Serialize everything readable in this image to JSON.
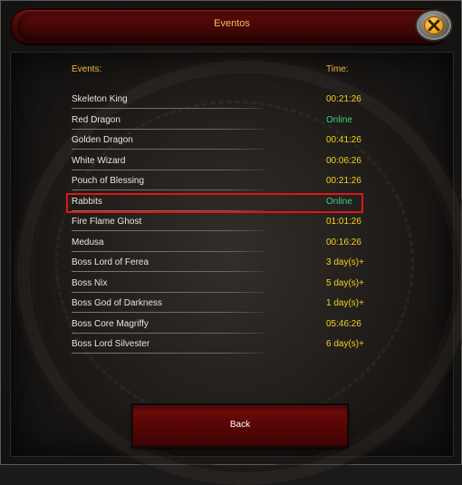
{
  "window": {
    "title": "Eventos"
  },
  "columns": {
    "events": "Events:",
    "time": "Time:"
  },
  "events": [
    {
      "name": "Skeleton King",
      "time": "00:21:26",
      "status": "countdown"
    },
    {
      "name": "Red Dragon",
      "time": "Online",
      "status": "online"
    },
    {
      "name": "Golden Dragon",
      "time": "00:41:26",
      "status": "countdown"
    },
    {
      "name": "White Wizard",
      "time": "00:06:26",
      "status": "countdown"
    },
    {
      "name": "Pouch of Blessing",
      "time": "00:21:26",
      "status": "countdown"
    },
    {
      "name": "Rabbits",
      "time": "Online",
      "status": "online",
      "highlighted": true
    },
    {
      "name": "Fire Flame Ghost",
      "time": "01:01:26",
      "status": "countdown"
    },
    {
      "name": "Medusa",
      "time": "00:16:26",
      "status": "countdown"
    },
    {
      "name": "Boss Lord of Ferea",
      "time": "3 day(s)+",
      "status": "countdown"
    },
    {
      "name": "Boss Nix",
      "time": "5 day(s)+",
      "status": "countdown"
    },
    {
      "name": "Boss God of Darkness",
      "time": "1 day(s)+",
      "status": "countdown"
    },
    {
      "name": "Boss Core Magriffy",
      "time": "05:46:26",
      "status": "countdown"
    },
    {
      "name": "Boss Lord Silvester",
      "time": "6 day(s)+",
      "status": "countdown"
    }
  ],
  "buttons": {
    "back_label": "Back",
    "close_icon": "close-x-icon"
  },
  "colors": {
    "header": "#f0b840",
    "title": "#f2c25a",
    "countdown": "#f5d21e",
    "online": "#3ed17a",
    "highlight": "#e11515",
    "event_name": "#e9e6df"
  }
}
